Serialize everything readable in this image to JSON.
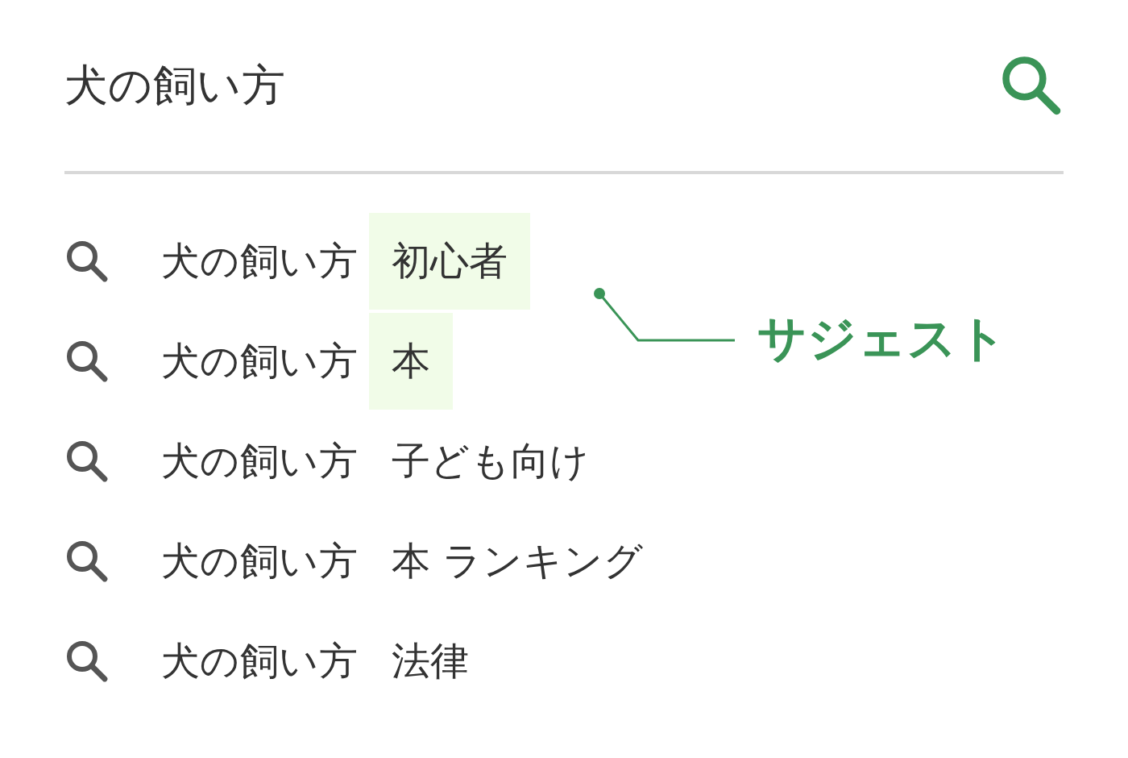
{
  "search": {
    "value": "犬の飼い方"
  },
  "suggestions": [
    {
      "prefix": "犬の飼い方",
      "suffix": "初心者",
      "highlighted": true
    },
    {
      "prefix": "犬の飼い方",
      "suffix": "本",
      "highlighted": true
    },
    {
      "prefix": "犬の飼い方",
      "suffix": "子ども向け",
      "highlighted": false
    },
    {
      "prefix": "犬の飼い方",
      "suffix": "本 ランキング",
      "highlighted": false
    },
    {
      "prefix": "犬の飼い方",
      "suffix": "法律",
      "highlighted": false
    }
  ],
  "callout": {
    "label": "サジェスト"
  }
}
